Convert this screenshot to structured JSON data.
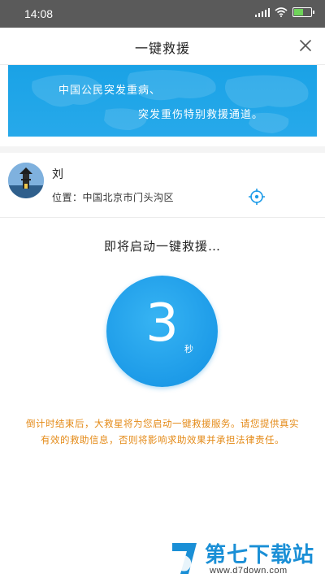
{
  "status_bar": {
    "time": "14:08",
    "battery_level": 0.55,
    "icons": [
      "signal-icon",
      "wifi-icon",
      "battery-charging-icon"
    ]
  },
  "nav": {
    "title": "一键救援",
    "close_icon": "close-icon"
  },
  "banner": {
    "line1": "中国公民突发重病、",
    "line2": "突发重伤特别救援通道。",
    "color": "#1da4e8"
  },
  "user": {
    "name": "刘",
    "location": "位置：中国北京市门头沟区",
    "locate_icon": "crosshair-icon"
  },
  "countdown": {
    "status_text": "即将启动一键救援…",
    "value": "3",
    "unit": "秒",
    "color": "#1d9be8"
  },
  "notice": {
    "text": "倒计时结束后，大救星将为您启动一键救援服务。请您提供真实有效的救助信息，否则将影响求助效果并承担法律责任。",
    "color": "#e48a17"
  },
  "watermark": {
    "site_name": "第七下载站",
    "url": "www.d7down.com",
    "color": "#1a8fd6"
  }
}
